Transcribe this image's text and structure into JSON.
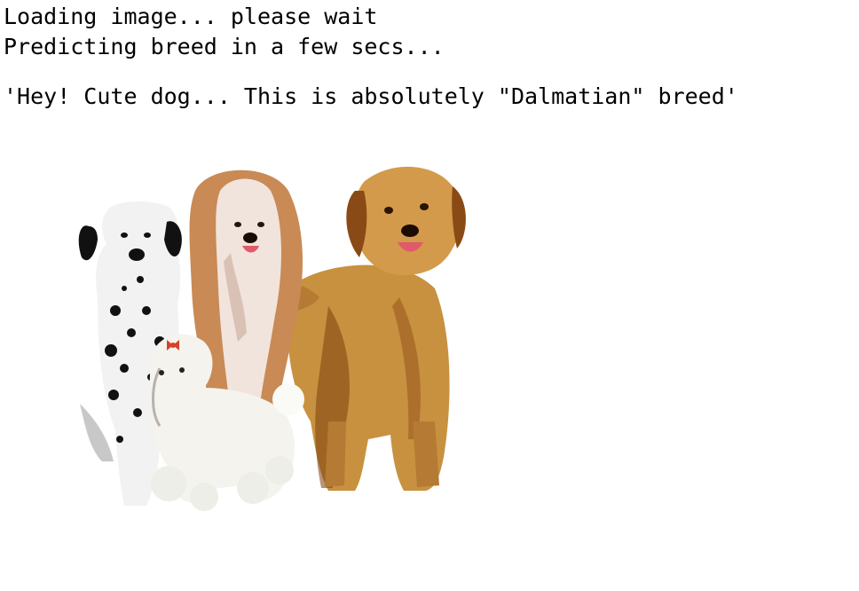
{
  "output": {
    "loading_line": "Loading image... please wait",
    "predicting_line": "Predicting breed in a few secs...",
    "result_line": "'Hey! Cute dog... This is absolutely \"Dalmatian\" breed'"
  },
  "image": {
    "subject": "group-of-dogs-illustration",
    "colors": {
      "background": "#ffffff",
      "golden_fur": "#c8913f",
      "golden_dark": "#7a3f0f",
      "collie_tan": "#c98a55",
      "poodle_white": "#f4f3ee",
      "dalmatian_spots": "#111111"
    }
  }
}
